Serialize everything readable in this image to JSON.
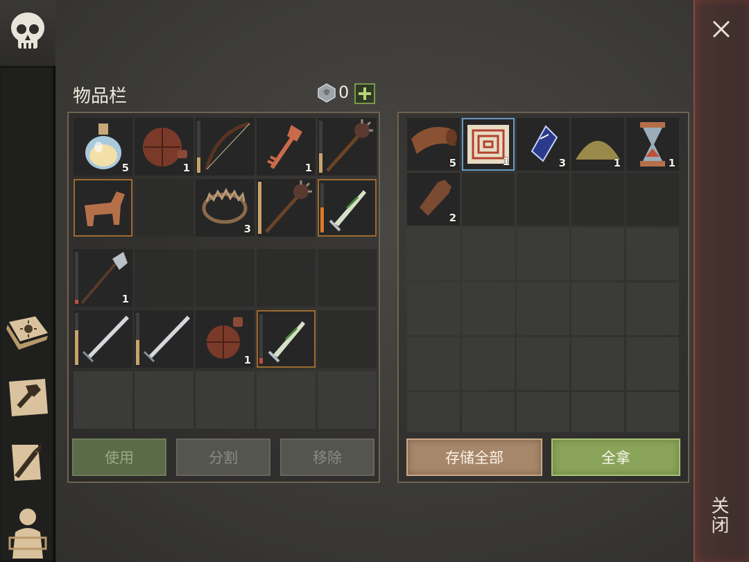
{
  "title": "物品栏",
  "currency": {
    "value": "0",
    "icon": "gem-coin-icon",
    "add_icon": "plus-icon"
  },
  "close": {
    "label": "关闭",
    "icon": "close-x-icon"
  },
  "rail": [
    {
      "name": "sun-book-icon"
    },
    {
      "name": "hammer-craft-icon"
    },
    {
      "name": "quill-scroll-icon"
    },
    {
      "name": "character-equipment-icon"
    }
  ],
  "skull_tab": {
    "icon": "skull-icon"
  },
  "inventory": {
    "row1": [
      {
        "item": "potion-flask",
        "count": "5"
      },
      {
        "item": "leather-waterskin",
        "count": "1"
      },
      {
        "item": "wooden-bow",
        "count": ""
      },
      {
        "item": "ornate-key",
        "count": "1"
      },
      {
        "item": "spiked-mace",
        "count": ""
      }
    ],
    "row2": [
      {
        "item": "wooden-horse",
        "count": ""
      },
      {
        "item": "",
        "count": ""
      },
      {
        "item": "bear-trap",
        "count": "3"
      },
      {
        "item": "spiked-mace",
        "count": ""
      },
      {
        "item": "green-dagger",
        "count": ""
      }
    ],
    "row3": [
      {
        "item": "halberd",
        "count": "1"
      },
      {
        "item": "",
        "count": ""
      },
      {
        "item": "",
        "count": ""
      },
      {
        "item": "",
        "count": ""
      },
      {
        "item": "",
        "count": ""
      }
    ],
    "row4": [
      {
        "item": "steel-sword",
        "count": ""
      },
      {
        "item": "steel-sword",
        "count": ""
      },
      {
        "item": "leather-waterskin",
        "count": "1"
      },
      {
        "item": "green-dagger",
        "count": ""
      },
      {
        "item": "",
        "count": ""
      }
    ]
  },
  "storage": {
    "row1": [
      {
        "item": "leather-roll",
        "count": "5"
      },
      {
        "item": "maze-map-scroll",
        "count": "1"
      },
      {
        "item": "blue-crystal",
        "count": "3"
      },
      {
        "item": "sand-pile",
        "count": "1"
      },
      {
        "item": "hourglass",
        "count": "1"
      }
    ],
    "row2": [
      {
        "item": "leather-bottle",
        "count": "2"
      }
    ]
  },
  "buttons": {
    "use": "使用",
    "split": "分割",
    "remove": "移除",
    "store_all": "存储全部",
    "take_all": "全拿"
  },
  "colors": {
    "accent_gold": "#c8a36a",
    "take_green": "#8aa45a",
    "close_red": "#8a4a40"
  }
}
